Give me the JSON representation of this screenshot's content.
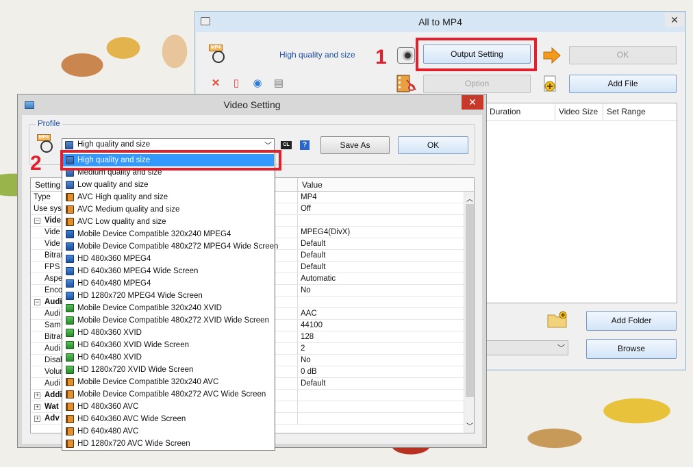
{
  "main_window": {
    "title": "All to MP4",
    "profile_text": "High quality and size",
    "output_setting_label": "Output Setting",
    "ok_label": "OK",
    "option_label": "Option",
    "add_file_label": "Add File",
    "add_folder_label": "Add Folder",
    "browse_label": "Browse",
    "columns": [
      "Duration",
      "Video Size",
      "Set Range"
    ],
    "close_symbol": "✕"
  },
  "annotations": {
    "step1": "1",
    "step2": "2",
    "color": "#e0212d"
  },
  "video_setting": {
    "title": "Video Setting",
    "profile_group_label": "Profile",
    "selected_profile": "High quality and size",
    "cl_icon_text": "CL",
    "help_icon_text": "?",
    "save_as_label": "Save As",
    "ok_label": "OK",
    "close_symbol": "✕",
    "header": {
      "setting": "Setting",
      "value": "Value"
    },
    "rows": [
      {
        "setting": "Type",
        "value": "MP4",
        "kind": "item"
      },
      {
        "setting": "Use syst",
        "value": "Off",
        "kind": "item"
      },
      {
        "setting": "Vide",
        "value": "",
        "kind": "group-open"
      },
      {
        "setting": "Vide",
        "value": "MPEG4(DivX)",
        "kind": "sub"
      },
      {
        "setting": "Vide",
        "value": "Default",
        "kind": "sub"
      },
      {
        "setting": "Bitrat",
        "value": "Default",
        "kind": "sub"
      },
      {
        "setting": "FPS",
        "value": "Default",
        "kind": "sub"
      },
      {
        "setting": "Aspe",
        "value": "Automatic",
        "kind": "sub"
      },
      {
        "setting": "Enco",
        "value": "No",
        "kind": "sub"
      },
      {
        "setting": "Audi",
        "value": "",
        "kind": "group-open"
      },
      {
        "setting": "Audi",
        "value": "AAC",
        "kind": "sub"
      },
      {
        "setting": "Sam",
        "value": "44100",
        "kind": "sub"
      },
      {
        "setting": "Bitrat",
        "value": "128",
        "kind": "sub"
      },
      {
        "setting": "Audi",
        "value": "2",
        "kind": "sub"
      },
      {
        "setting": "Disab",
        "value": "No",
        "kind": "sub"
      },
      {
        "setting": "Volur",
        "value": "0 dB",
        "kind": "sub"
      },
      {
        "setting": "Audi",
        "value": "Default",
        "kind": "sub"
      },
      {
        "setting": "Addi",
        "value": "",
        "kind": "group-closed"
      },
      {
        "setting": "Wat",
        "value": "",
        "kind": "group-closed"
      },
      {
        "setting": "Adv",
        "value": "",
        "kind": "group-closed"
      }
    ]
  },
  "dropdown": {
    "items": [
      {
        "label": "High quality and size",
        "icon": "blue",
        "selected": true
      },
      {
        "label": "Medium quality and size",
        "icon": "blue"
      },
      {
        "label": "Low quality and size",
        "icon": "blue"
      },
      {
        "label": "AVC High quality and size",
        "icon": "film"
      },
      {
        "label": "AVC Medium quality and size",
        "icon": "film"
      },
      {
        "label": "AVC Low quality and size",
        "icon": "film"
      },
      {
        "label": "Mobile Device Compatible 320x240 MPEG4",
        "icon": "dev"
      },
      {
        "label": "Mobile Device Compatible 480x272 MPEG4 Wide Screen",
        "icon": "dev"
      },
      {
        "label": "HD 480x360 MPEG4",
        "icon": "hd"
      },
      {
        "label": "HD 640x360 MPEG4 Wide Screen",
        "icon": "hd"
      },
      {
        "label": "HD 640x480 MPEG4",
        "icon": "hd"
      },
      {
        "label": "HD 1280x720 MPEG4 Wide Screen",
        "icon": "hd"
      },
      {
        "label": "Mobile Device Compatible 320x240 XVID",
        "icon": "xvid"
      },
      {
        "label": "Mobile Device Compatible 480x272 XVID Wide Screen",
        "icon": "xvid"
      },
      {
        "label": "HD 480x360 XVID",
        "icon": "xvid"
      },
      {
        "label": "HD 640x360 XVID Wide Screen",
        "icon": "xvid"
      },
      {
        "label": "HD 640x480 XVID",
        "icon": "xvid"
      },
      {
        "label": "HD 1280x720 XVID Wide Screen",
        "icon": "xvid"
      },
      {
        "label": "Mobile Device Compatible 320x240 AVC",
        "icon": "film"
      },
      {
        "label": "Mobile Device Compatible 480x272 AVC Wide Screen",
        "icon": "film"
      },
      {
        "label": "HD 480x360 AVC",
        "icon": "film"
      },
      {
        "label": "HD 640x360 AVC Wide Screen",
        "icon": "film"
      },
      {
        "label": "HD 640x480 AVC",
        "icon": "film"
      },
      {
        "label": "HD 1280x720 AVC Wide Screen",
        "icon": "film"
      }
    ]
  },
  "colors": {
    "accent_red": "#e0212d",
    "selection_blue": "#3399ff",
    "title_close": "#c7392b"
  }
}
